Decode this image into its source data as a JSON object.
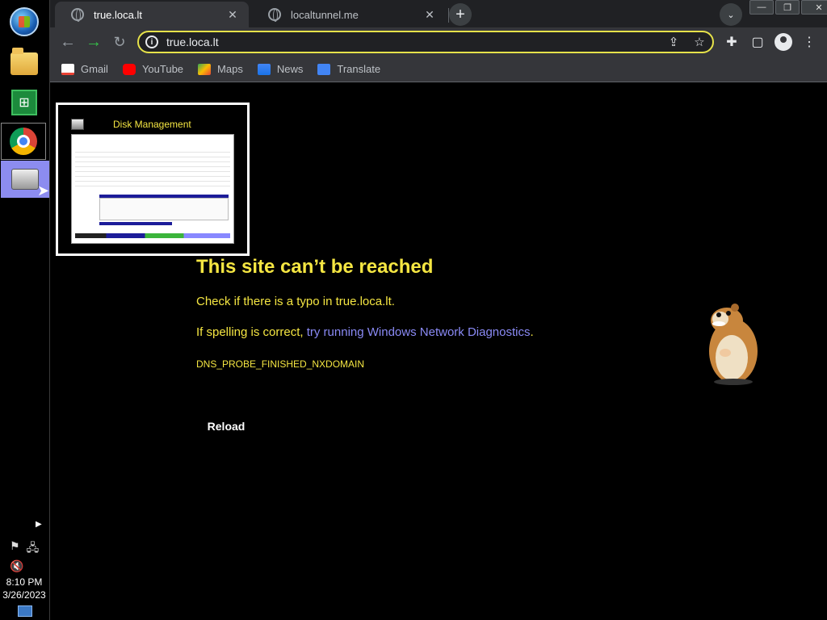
{
  "taskbar": {
    "clock_time": "8:10 PM",
    "clock_date": "3/26/2023"
  },
  "browser": {
    "tabs": [
      {
        "title": "true.loca.lt",
        "close": "✕"
      },
      {
        "title": "localtunnel.me",
        "close": "✕"
      }
    ],
    "new_tab": "+",
    "tab_search": "⌄",
    "window": {
      "minimize": "—",
      "restore": "❐",
      "close": "✕"
    },
    "address": "true.loca.lt",
    "bookmarks": [
      {
        "label": "Gmail"
      },
      {
        "label": "YouTube"
      },
      {
        "label": "Maps"
      },
      {
        "label": "News"
      },
      {
        "label": "Translate"
      }
    ]
  },
  "overlay": {
    "title": "Disk Management"
  },
  "error_page": {
    "title": "This site can’t be reached",
    "line1": "Check if there is a typo in true.loca.lt.",
    "line2_prefix": "If spelling is correct, ",
    "line2_link": "try running Windows Network Diagnostics",
    "line2_suffix": ".",
    "code": "DNS_PROBE_FINISHED_NXDOMAIN",
    "reload": "Reload"
  },
  "colors": {
    "error_text": "#f5e642",
    "link": "#8a8af5",
    "omnibox_focus": "#e6e24a"
  }
}
